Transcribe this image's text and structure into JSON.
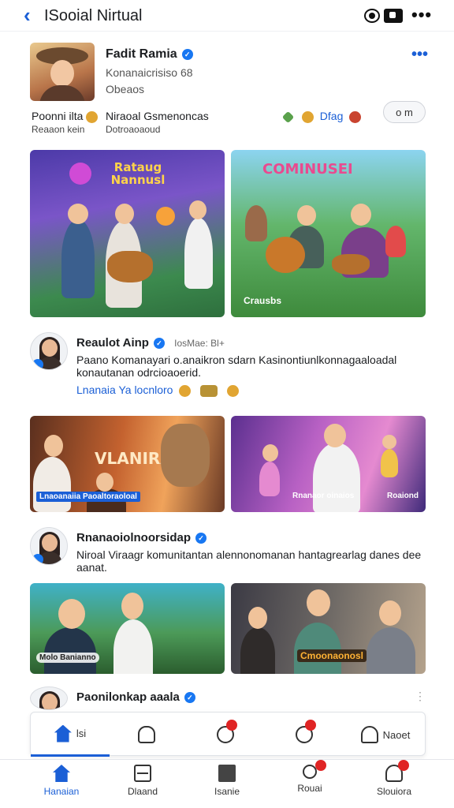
{
  "app": {
    "title": "ISooial Nirtual"
  },
  "profile": {
    "name": "Fadit Ramia",
    "subtitle": "Konanaicrisiso 68",
    "subtitle2": "Obeaos",
    "stats_label": "Poonni ilta",
    "stats_sub": "Reaaon kein",
    "interests": "Niraoal  Gsmenoncas",
    "interests_sub": "Dotroaoaoud",
    "tag": "Dfag",
    "toggle_label": "o  m"
  },
  "card1": {
    "title_art": "Rataug Nannusl"
  },
  "card2": {
    "title_art": "COMINUSEI",
    "caption": "Crausbs"
  },
  "post1": {
    "name": "Reaulot Ainp",
    "meta": "IosMae: Bl+",
    "text": "Paano Komanayari o.anaikron sdarn Kasinontiunlkonnagaaloadal konautanan odrcioaoerid.",
    "tags": "Lnanaia Ya locnloro"
  },
  "card3": {
    "title_art": "VLANIRA",
    "caption": "Lnaoanaiia Paoaltoraoloal"
  },
  "card4": {
    "caption": "Rnanaor oinaios",
    "caption2": "Roaiond"
  },
  "post2": {
    "name": "Rnanaoiolnoorsidap",
    "text": "Niroal   Viraagr komunitantan alennonomanan hantagrearlag danes dee aanat."
  },
  "card5": {
    "caption": "Molo Banianno"
  },
  "card6": {
    "caption": "Cmoonaonosl"
  },
  "post3": {
    "name": "Paonilonkap aaala"
  },
  "floatbar": {
    "items": [
      {
        "label": "lsi",
        "icon": "home-icon"
      },
      {
        "label": "",
        "icon": "bell-icon"
      },
      {
        "label": "",
        "icon": "refresh-icon"
      },
      {
        "label": "",
        "icon": "chat-icon"
      },
      {
        "label": "Naoet",
        "icon": "person-icon"
      }
    ]
  },
  "nav": {
    "items": [
      {
        "label": "Hanaian",
        "icon": "home-icon"
      },
      {
        "label": "Dlaand",
        "icon": "grid-icon"
      },
      {
        "label": "Isanie",
        "icon": "note-icon"
      },
      {
        "label": "Rouai",
        "icon": "search-icon"
      },
      {
        "label": "Slouiora",
        "icon": "profile-icon"
      }
    ]
  },
  "colors": {
    "accent": "#1b5fd6",
    "badge": "#e02424",
    "verified": "#1877f2"
  }
}
